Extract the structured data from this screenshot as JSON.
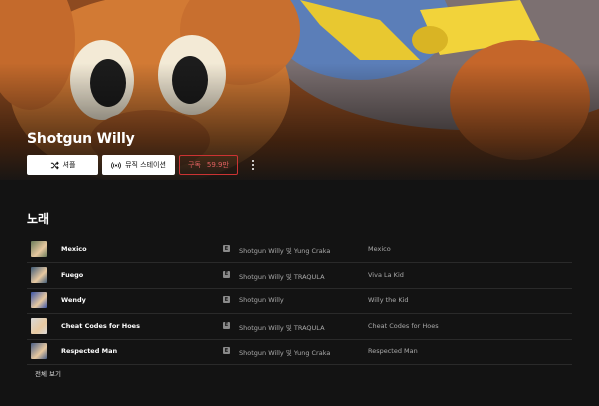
{
  "artist": {
    "name": "Shotgun Willy"
  },
  "actions": {
    "shuffle_label": "셔플",
    "radio_label": "뮤직 스테이션",
    "subscribe_label": "구독",
    "subscribe_count": "59.9만"
  },
  "songs_section": {
    "title": "노래",
    "see_all": "전체 보기"
  },
  "songs": [
    {
      "title": "Mexico",
      "explicit": "E",
      "artist": "Shotgun Willy 및 Yung Craka",
      "album": "Mexico",
      "thumb_color": "#6a7c5a"
    },
    {
      "title": "Fuego",
      "explicit": "E",
      "artist": "Shotgun Willy 및 TRAQULA",
      "album": "Viva La Kid",
      "thumb_color": "#3f5b78"
    },
    {
      "title": "Wendy",
      "explicit": "E",
      "artist": "Shotgun Willy",
      "album": "Willy the Kid",
      "thumb_color": "#3b55a8"
    },
    {
      "title": "Cheat Codes for Hoes",
      "explicit": "E",
      "artist": "Shotgun Willy 및 TRAQULA",
      "album": "Cheat Codes for Hoes",
      "thumb_color": "#d9d9d9"
    },
    {
      "title": "Respected Man",
      "explicit": "E",
      "artist": "Shotgun Willy 및 Yung Craka",
      "album": "Respected Man",
      "thumb_color": "#4a5f86"
    }
  ]
}
